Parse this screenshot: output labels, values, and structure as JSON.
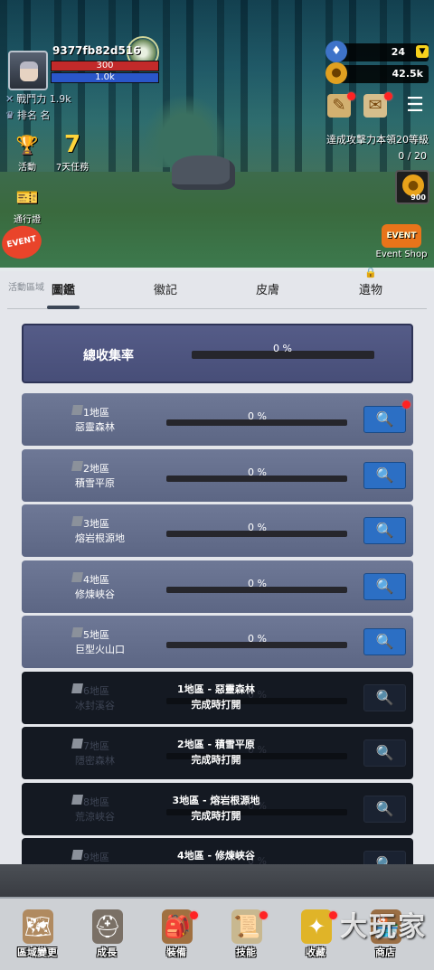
{
  "player": {
    "name": "9377fb82d516",
    "hp": "300",
    "mp": "1.0k",
    "power_label": "戰鬥力",
    "power": "1.9k",
    "rank_label": "排名",
    "rank": "名"
  },
  "currency": {
    "gems": "24",
    "gold": "42.5k",
    "plus": "▼"
  },
  "side_buttons": {
    "activity": "活動",
    "seven_day": "7天任務",
    "pass": "通行證",
    "seven_glyph": "7"
  },
  "quest": {
    "text": "達成攻擊力本領20等級",
    "progress": "0 / 20"
  },
  "coin_reward": "900",
  "event_shop": {
    "banner": "EVENT",
    "label": "Event Shop"
  },
  "event_side": "EVENT",
  "panel": {
    "side_label": "活動區域",
    "tabs": [
      "圖鑑",
      "徽記",
      "皮膚",
      "遺物"
    ],
    "total_label": "總收集率",
    "total_pct": "0 %",
    "regions": [
      {
        "num": "1地區",
        "name": "惡靈森林",
        "pct": "0 %",
        "locked": false
      },
      {
        "num": "2地區",
        "name": "積雪平原",
        "pct": "0 %",
        "locked": false
      },
      {
        "num": "3地區",
        "name": "熔岩根源地",
        "pct": "0 %",
        "locked": false
      },
      {
        "num": "4地區",
        "name": "修煉峽谷",
        "pct": "0 %",
        "locked": false
      },
      {
        "num": "5地區",
        "name": "巨型火山口",
        "pct": "0 %",
        "locked": false
      },
      {
        "num": "6地區",
        "name": "冰封溪谷",
        "pct": "0 %",
        "locked": true,
        "msg1": "1地區 - 惡靈森林",
        "msg2": "完成時打開"
      },
      {
        "num": "7地區",
        "name": "隱密森林",
        "pct": "0 %",
        "locked": true,
        "msg1": "2地區 - 積雪平原",
        "msg2": "完成時打開"
      },
      {
        "num": "8地區",
        "name": "荒涼峽谷",
        "pct": "0 %",
        "locked": true,
        "msg1": "3地區 - 熔岩根源地",
        "msg2": "完成時打開"
      },
      {
        "num": "9地區",
        "name": "",
        "pct": "0 %",
        "locked": true,
        "msg1": "4地區 - 修煉峽谷",
        "msg2": ""
      }
    ]
  },
  "nav": [
    {
      "label": "區域變更",
      "icon": "map-icon"
    },
    {
      "label": "成長",
      "icon": "helmet-icon"
    },
    {
      "label": "裝備",
      "icon": "backpack-icon"
    },
    {
      "label": "技能",
      "icon": "scroll-icon"
    },
    {
      "label": "收藏",
      "icon": "collection-icon"
    },
    {
      "label": "商店",
      "icon": "shop-icon"
    }
  ],
  "watermark": "大玩家",
  "colors": {
    "accent": "#2c6fc4",
    "hp": "#c22a2a",
    "mp": "#2a56c9",
    "badge": "#ff2323"
  }
}
